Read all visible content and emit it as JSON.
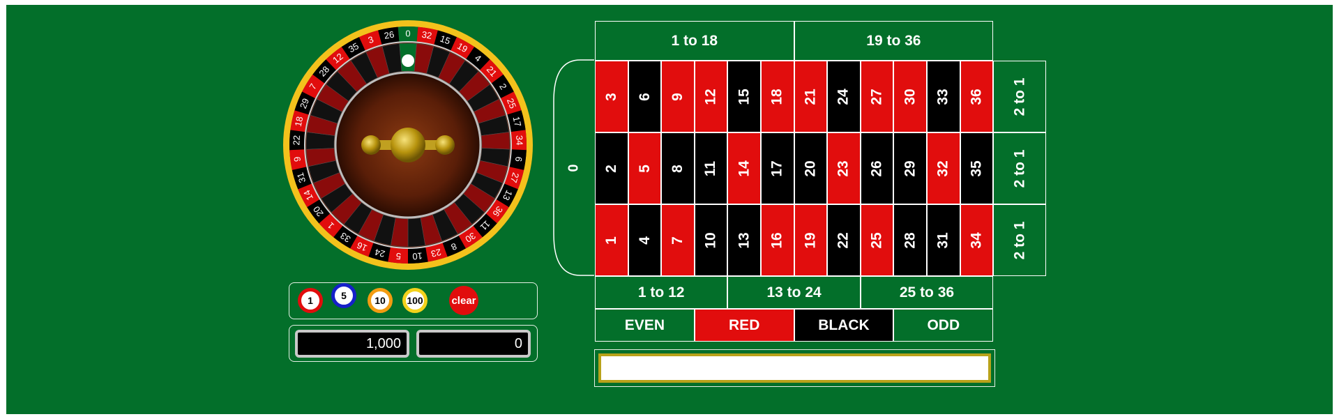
{
  "colors": {
    "felt": "#036f2a",
    "red": "#e10d0d",
    "black": "#000000",
    "gold": "#f3c21c",
    "rim": "#ffffff"
  },
  "wheel": {
    "numbers": [
      "0",
      "32",
      "15",
      "19",
      "4",
      "21",
      "2",
      "25",
      "17",
      "34",
      "6",
      "27",
      "13",
      "36",
      "11",
      "30",
      "8",
      "23",
      "10",
      "5",
      "24",
      "16",
      "33",
      "1",
      "20",
      "14",
      "31",
      "9",
      "22",
      "18",
      "29",
      "7",
      "28",
      "12",
      "35",
      "3",
      "26"
    ],
    "ball_position": "0"
  },
  "chips": [
    {
      "label": "1",
      "ring": "#e10d0d"
    },
    {
      "label": "5",
      "ring": "#1620c9"
    },
    {
      "label": "10",
      "ring": "#f39c12"
    },
    {
      "label": "100",
      "ring": "#f3d21c"
    }
  ],
  "clear_label": "clear",
  "bank_value": "1,000",
  "bet_value": "0",
  "table": {
    "zero": "0",
    "rows": [
      [
        {
          "n": "3",
          "c": "red"
        },
        {
          "n": "6",
          "c": "black"
        },
        {
          "n": "9",
          "c": "red"
        },
        {
          "n": "12",
          "c": "red"
        },
        {
          "n": "15",
          "c": "black"
        },
        {
          "n": "18",
          "c": "red"
        },
        {
          "n": "21",
          "c": "red"
        },
        {
          "n": "24",
          "c": "black"
        },
        {
          "n": "27",
          "c": "red"
        },
        {
          "n": "30",
          "c": "red"
        },
        {
          "n": "33",
          "c": "black"
        },
        {
          "n": "36",
          "c": "red"
        }
      ],
      [
        {
          "n": "2",
          "c": "black"
        },
        {
          "n": "5",
          "c": "red"
        },
        {
          "n": "8",
          "c": "black"
        },
        {
          "n": "11",
          "c": "black"
        },
        {
          "n": "14",
          "c": "red"
        },
        {
          "n": "17",
          "c": "black"
        },
        {
          "n": "20",
          "c": "black"
        },
        {
          "n": "23",
          "c": "red"
        },
        {
          "n": "26",
          "c": "black"
        },
        {
          "n": "29",
          "c": "black"
        },
        {
          "n": "32",
          "c": "red"
        },
        {
          "n": "35",
          "c": "black"
        }
      ],
      [
        {
          "n": "1",
          "c": "red"
        },
        {
          "n": "4",
          "c": "black"
        },
        {
          "n": "7",
          "c": "red"
        },
        {
          "n": "10",
          "c": "black"
        },
        {
          "n": "13",
          "c": "black"
        },
        {
          "n": "16",
          "c": "red"
        },
        {
          "n": "19",
          "c": "red"
        },
        {
          "n": "22",
          "c": "black"
        },
        {
          "n": "25",
          "c": "red"
        },
        {
          "n": "28",
          "c": "black"
        },
        {
          "n": "31",
          "c": "black"
        },
        {
          "n": "34",
          "c": "red"
        }
      ]
    ],
    "columns": [
      "2 to 1",
      "2 to 1",
      "2 to 1"
    ],
    "halves": [
      "1 to 18",
      "19 to 36"
    ],
    "dozens": [
      "1 to 12",
      "13 to 24",
      "25 to 36"
    ],
    "outside": [
      "EVEN",
      "RED",
      "BLACK",
      "ODD"
    ]
  },
  "message": ""
}
